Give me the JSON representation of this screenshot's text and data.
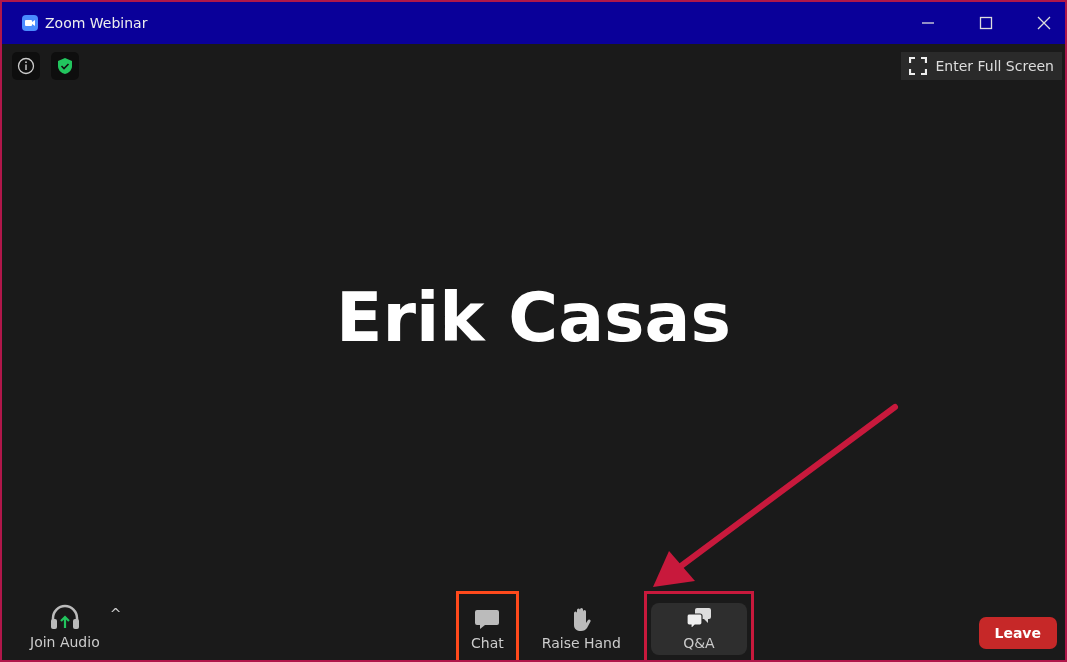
{
  "window": {
    "title": "Zoom Webinar"
  },
  "top_left_buttons": [
    {
      "kind": "info"
    },
    {
      "kind": "shield"
    }
  ],
  "fullscreen_button": {
    "label": "Enter Full Screen"
  },
  "speaker_name": "Erik Casas",
  "join_audio": {
    "label": "Join Audio",
    "caret": "^"
  },
  "toolbar": [
    {
      "kind": "chat",
      "label": "Chat",
      "selected": false,
      "color": "#ff4a1c"
    },
    {
      "kind": "hand",
      "label": "Raise Hand",
      "selected": false
    },
    {
      "kind": "qa",
      "label": "Q&A",
      "selected": true,
      "color": "#c8193c"
    }
  ],
  "arrow": {
    "color": "#c8193c"
  },
  "leave_button": {
    "label": "Leave"
  }
}
